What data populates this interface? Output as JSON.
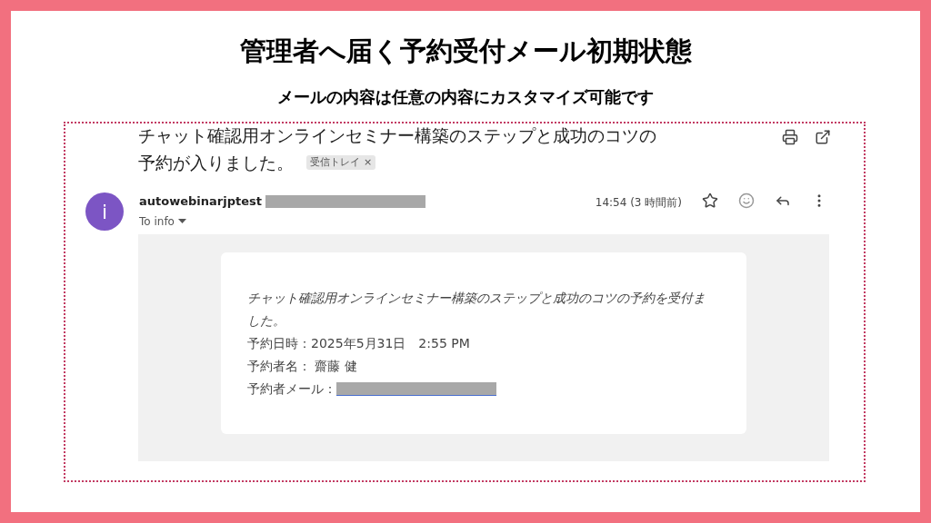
{
  "heading": "管理者へ届く予約受付メール初期状態",
  "subheading": "メールの内容は任意の内容にカスタマイズ可能です",
  "email": {
    "subject_lines": [
      "チャット確認用オンラインセミナー構築のステップと成功のコツの",
      "予約が入りました。"
    ],
    "label": {
      "text": "受信トレイ",
      "remove": "×"
    },
    "sender": {
      "avatar_letter": "i",
      "name": "autowebinarjptest"
    },
    "recipient": "To info",
    "time": "14:54 (3 時間前)",
    "body": {
      "intro": "チャット確認用オンラインセミナー構築のステップと成功のコツの予約を受付ました。",
      "lines": [
        {
          "text": "予約日時：2025年5月31日　2:55 PM",
          "redacted": false
        },
        {
          "text": "予約者名： 齋藤 健",
          "redacted": false
        },
        {
          "text": "予約者メール：",
          "redacted": true
        }
      ]
    }
  }
}
